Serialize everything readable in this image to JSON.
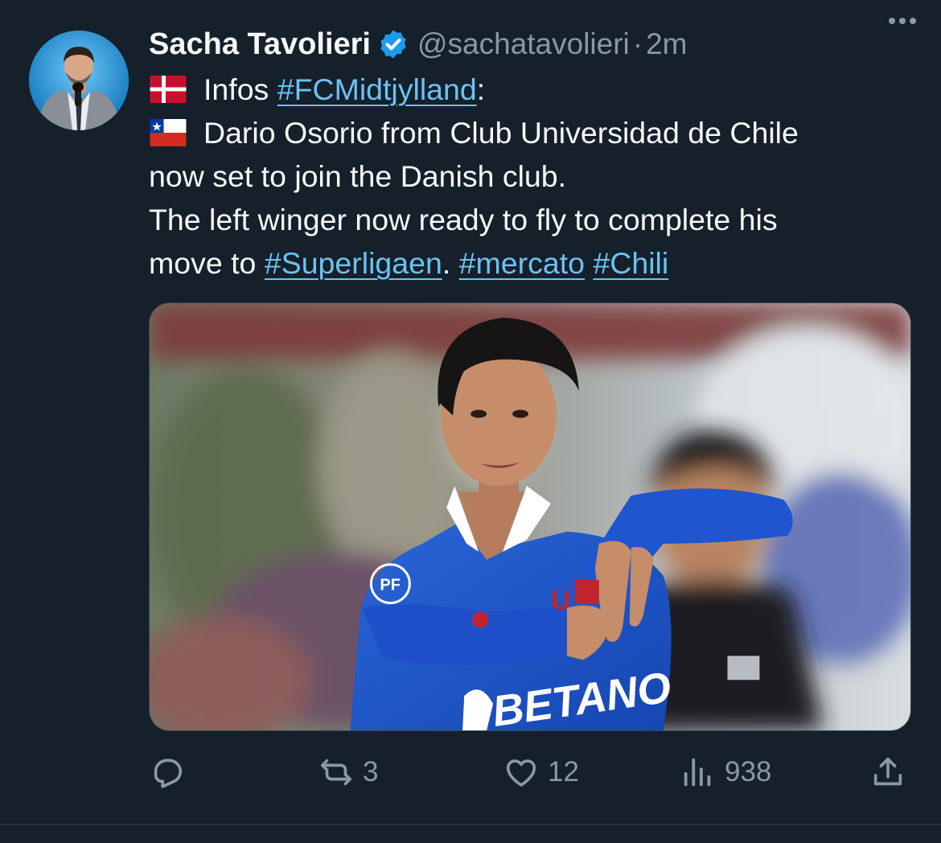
{
  "author": {
    "name": "Sacha Tavolieri",
    "handle": "@sachatavolieri",
    "separator": "·",
    "time": "2m",
    "verified": true
  },
  "post": {
    "line1_text": "Infos",
    "line1_tag": "#FCMidtjylland",
    "line1_suffix": ":",
    "line2_text": "Dario Osorio from Club Universidad de Chile",
    "line3_text": "now set to join the Danish club.",
    "line4_text": "The left winger now ready to fly to complete his",
    "line5_text": "move to",
    "tag_superligaen": "#Superligaen",
    "period": ".",
    "tag_mercato": "#mercato",
    "tag_chili": "#Chili",
    "sponsor_text": "BETANO",
    "badge_text": "PF",
    "flags": [
      "denmark-flag",
      "chile-flag"
    ]
  },
  "actions": {
    "reply": {
      "icon": "reply-icon",
      "count": ""
    },
    "repost": {
      "icon": "repost-icon",
      "count": "3"
    },
    "like": {
      "icon": "heart-icon",
      "count": "12"
    },
    "views": {
      "icon": "views-icon",
      "count": "938"
    },
    "share": {
      "icon": "share-icon",
      "count": ""
    }
  },
  "colors": {
    "background": "#15202b",
    "link": "#6cc2f3",
    "secondary_text": "#8b98a5",
    "verified": "#1d9bf0"
  }
}
